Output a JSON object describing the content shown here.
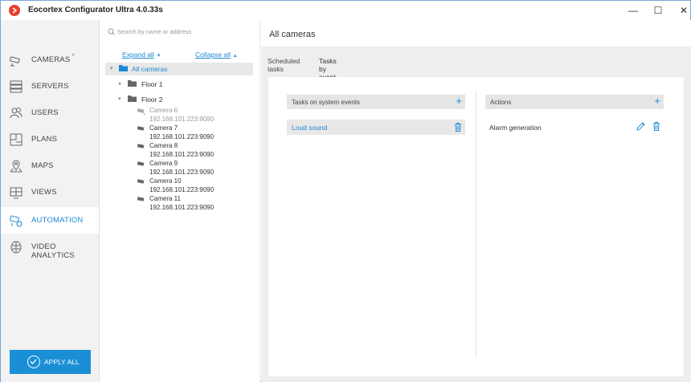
{
  "window": {
    "title": "Eocortex Configurator Ultra 4.0.33s",
    "controls": {
      "minimize": "—",
      "maximize": "☐",
      "close": "✕"
    }
  },
  "colors": {
    "accent": "#1a8ad4",
    "logo": "#e53e2b",
    "sidebar_bg": "#f2f2f2",
    "content_bg": "#eeeeee"
  },
  "sidebar": {
    "items": [
      {
        "label": "CAMERAS",
        "badge": "*",
        "icon": "camera-icon"
      },
      {
        "label": "SERVERS",
        "icon": "servers-icon"
      },
      {
        "label": "USERS",
        "icon": "users-icon"
      },
      {
        "label": "PLANS",
        "icon": "plans-icon"
      },
      {
        "label": "MAPS",
        "icon": "map-pin-icon"
      },
      {
        "label": "VIEWS",
        "icon": "views-icon"
      },
      {
        "label": "AUTOMATION",
        "icon": "automation-icon",
        "active": true
      },
      {
        "label": "VIDEO ANALYTICS",
        "icon": "brain-icon"
      }
    ],
    "apply_button": "APPLY ALL"
  },
  "tree": {
    "search_placeholder": "Search by name or address",
    "expand_all": "Expand all",
    "collapse_all": "Collapse all",
    "root": "All cameras",
    "folders": [
      "Floor 1",
      "Floor 2"
    ],
    "cameras": [
      {
        "name": "Camera 6",
        "address": "192.168.101.223:9090",
        "disabled": true
      },
      {
        "name": "Camera 7",
        "address": "192.168.101.223:9090"
      },
      {
        "name": "Camera 8",
        "address": "192.168.101.223:9090"
      },
      {
        "name": "Camera 9",
        "address": "192.168.101.223:9090"
      },
      {
        "name": "Camera 10",
        "address": "192.168.101.223:9090"
      },
      {
        "name": "Camera 11",
        "address": "192.168.101.223:9090"
      }
    ]
  },
  "main": {
    "title": "All cameras",
    "tabs": [
      {
        "label": "Scheduled tasks",
        "active": false
      },
      {
        "label": "Tasks by event",
        "active": true
      }
    ],
    "tasks_panel": {
      "header": "Tasks on system events",
      "items": [
        "Loud sound"
      ]
    },
    "actions_panel": {
      "header": "Actions",
      "items": [
        "Alarm generation"
      ]
    }
  }
}
